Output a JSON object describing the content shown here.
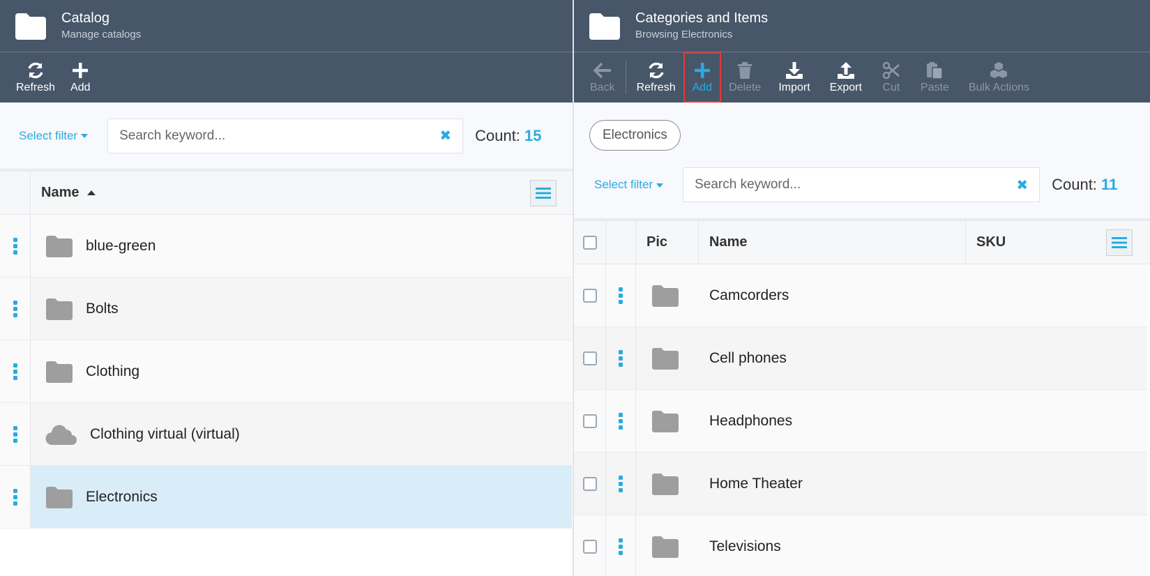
{
  "left": {
    "title": "Catalog",
    "subtitle": "Manage catalogs",
    "toolbar": {
      "refresh": "Refresh",
      "add": "Add"
    },
    "filter_label": "Select filter",
    "search_placeholder": "Search keyword...",
    "count_label": "Count:",
    "count": "15",
    "column_name": "Name",
    "rows": [
      {
        "label": "blue-green",
        "icon": "folder-icon"
      },
      {
        "label": "Bolts",
        "icon": "folder-icon"
      },
      {
        "label": "Clothing",
        "icon": "folder-icon"
      },
      {
        "label": "Clothing virtual (virtual)",
        "icon": "cloud-icon"
      },
      {
        "label": "Electronics",
        "icon": "folder-icon",
        "selected": true
      }
    ]
  },
  "right": {
    "title": "Categories and Items",
    "subtitle": "Browsing Electronics",
    "toolbar": {
      "back": "Back",
      "refresh": "Refresh",
      "add": "Add",
      "delete": "Delete",
      "import": "Import",
      "export": "Export",
      "cut": "Cut",
      "paste": "Paste",
      "bulk_actions": "Bulk Actions"
    },
    "breadcrumb_chip": "Electronics",
    "filter_label": "Select filter",
    "search_placeholder": "Search keyword...",
    "count_label": "Count:",
    "count": "11",
    "columns": {
      "pic": "Pic",
      "name": "Name",
      "sku": "SKU"
    },
    "rows": [
      {
        "label": "Camcorders"
      },
      {
        "label": "Cell phones"
      },
      {
        "label": "Headphones"
      },
      {
        "label": "Home Theater"
      },
      {
        "label": "Televisions"
      }
    ]
  },
  "colors": {
    "header_bg": "#475669",
    "accent": "#29abe2",
    "selected_row": "#d9edf9",
    "highlight_border": "#e53935"
  }
}
